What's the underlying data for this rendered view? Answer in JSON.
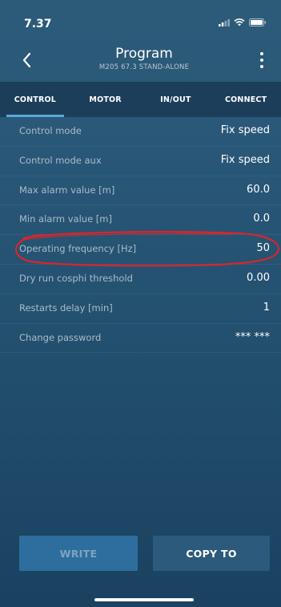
{
  "status_bar": {
    "time": "7.37"
  },
  "header": {
    "title": "Program",
    "subtitle": "M205 67.3 STAND-ALONE"
  },
  "tabs": [
    {
      "label": "CONTROL",
      "active": true
    },
    {
      "label": "MOTOR",
      "active": false
    },
    {
      "label": "IN/OUT",
      "active": false
    },
    {
      "label": "CONNECT",
      "active": false
    }
  ],
  "settings": [
    {
      "label": "Control mode",
      "value": "Fix speed"
    },
    {
      "label": "Control mode aux",
      "value": "Fix speed"
    },
    {
      "label": "Max alarm value [m]",
      "value": "60.0"
    },
    {
      "label": "Min alarm value [m]",
      "value": "0.0"
    },
    {
      "label": "Operating frequency [Hz]",
      "value": "50"
    },
    {
      "label": "Dry run cosphi threshold",
      "value": "0.00"
    },
    {
      "label": "Restarts delay [min]",
      "value": "1"
    },
    {
      "label": "Change password",
      "value": "*** ***"
    }
  ],
  "buttons": {
    "write": "WRITE",
    "copy_to": "COPY TO"
  },
  "colors": {
    "background": "#25527a",
    "tab_bar": "#1d3e5a",
    "tab_indicator": "#5aa8d8",
    "annotation": "#d9262b"
  }
}
